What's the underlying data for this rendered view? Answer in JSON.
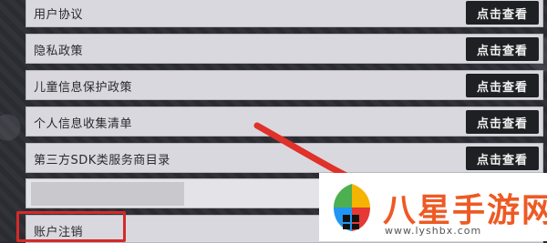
{
  "rows": [
    {
      "label": "用户协议",
      "button": "点击查看"
    },
    {
      "label": "隐私政策",
      "button": "点击查看"
    },
    {
      "label": "儿童信息保护政策",
      "button": "点击查看"
    },
    {
      "label": "个人信息收集清单",
      "button": "点击查看"
    },
    {
      "label": "第三方SDK类服务商目录",
      "button": "点击查看"
    }
  ],
  "cancel_label": "账户注销",
  "watermark": {
    "title": "八星手游网",
    "url": "www.lyshbx.com"
  },
  "colors": {
    "highlight": "#d42a2a",
    "arrow": "#e0312a"
  }
}
